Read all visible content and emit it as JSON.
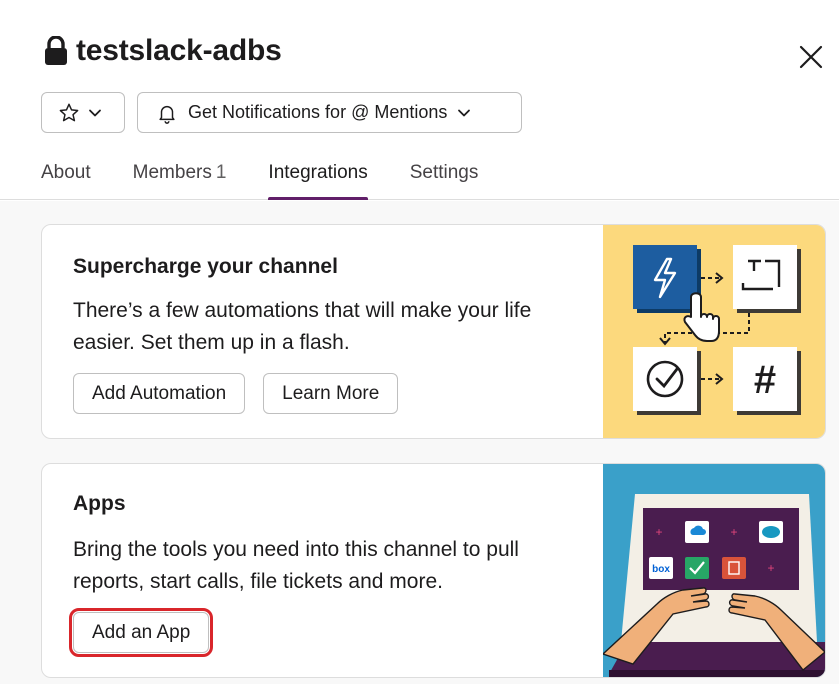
{
  "header": {
    "channel_name": "testslack-adbs",
    "notifications_label": "Get Notifications for @ Mentions"
  },
  "tabs": [
    {
      "label": "About",
      "count": ""
    },
    {
      "label": "Members",
      "count": "1"
    },
    {
      "label": "Integrations",
      "count": ""
    },
    {
      "label": "Settings",
      "count": ""
    }
  ],
  "active_tab": "Integrations",
  "automation_card": {
    "title": "Supercharge your channel",
    "text": "There’s a few automations that will make your life easier. Set them up in a flash.",
    "primary_button": "Add Automation",
    "secondary_button": "Learn More"
  },
  "apps_card": {
    "title": "Apps",
    "text": "Bring the tools you need into this channel to pull reports, start calls, file tickets and more.",
    "button": "Add an App"
  },
  "illustration_labels": {
    "box_logo": "box",
    "hash_symbol": "#"
  },
  "colors": {
    "accent_tab": "#611f69",
    "highlight": "#d9262b",
    "automation_bg": "#fcd97d",
    "apps_bg": "#3aa0c9",
    "bolt_tile": "#1d5da0",
    "laptop_screen": "#4a1d4f"
  },
  "icons": [
    "lock-icon",
    "close-icon",
    "star-icon",
    "chevron-down-icon",
    "bell-icon"
  ]
}
